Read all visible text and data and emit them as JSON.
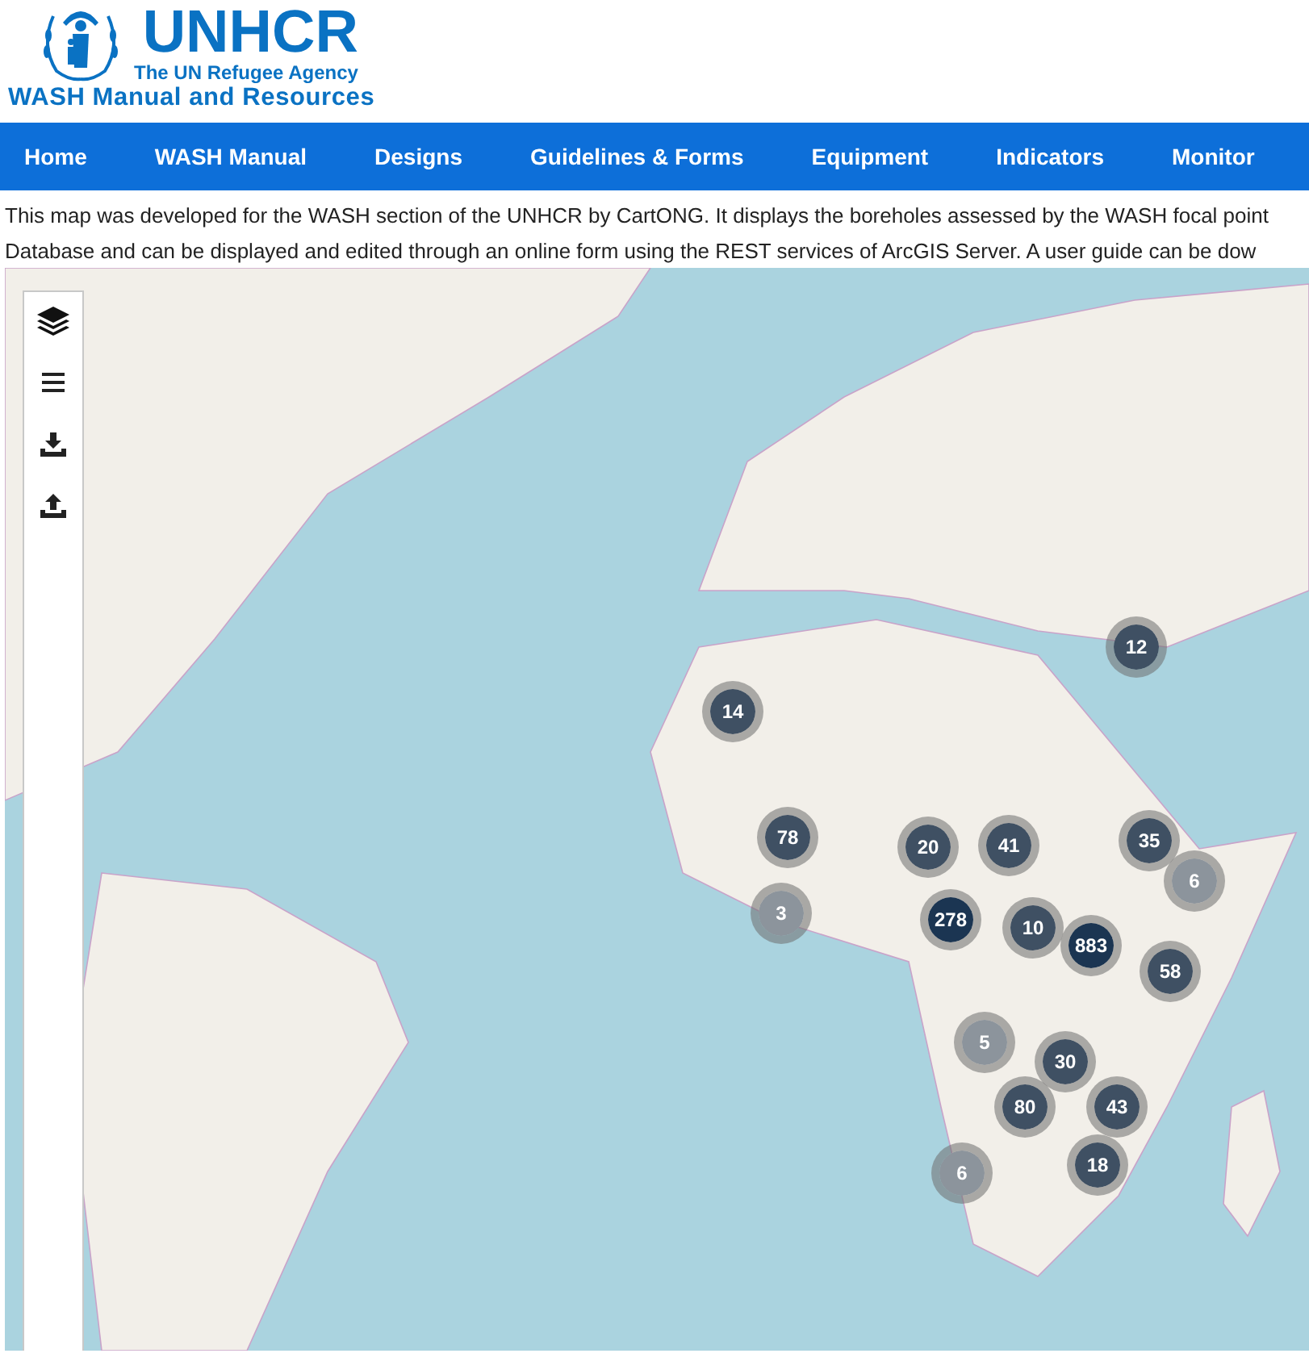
{
  "header": {
    "logo_title": "UNHCR",
    "logo_subtitle": "The UN Refugee Agency",
    "site_title": "WASH Manual and Resources"
  },
  "nav": [
    {
      "label": "Home"
    },
    {
      "label": "WASH Manual"
    },
    {
      "label": "Designs"
    },
    {
      "label": "Guidelines & Forms"
    },
    {
      "label": "Equipment"
    },
    {
      "label": "Indicators"
    },
    {
      "label": "Monitor"
    }
  ],
  "intro": [
    "This map was developed for the WASH section of the UNHCR by CartONG. It displays the boreholes assessed by the WASH focal point",
    "Database and can be displayed and edited through an online form using the REST services of ArcGIS Server. A user guide can be dow"
  ],
  "map": {
    "clusters": [
      {
        "count": "12",
        "color": "#3f5063"
      },
      {
        "count": "14",
        "color": "#3f5063"
      },
      {
        "count": "78",
        "color": "#3f5063"
      },
      {
        "count": "20",
        "color": "#3f5063"
      },
      {
        "count": "41",
        "color": "#3f5063"
      },
      {
        "count": "35",
        "color": "#3f5063"
      },
      {
        "count": "6",
        "color": "#8c949c"
      },
      {
        "count": "3",
        "color": "#8c949c"
      },
      {
        "count": "278",
        "color": "#1b3552"
      },
      {
        "count": "10",
        "color": "#3f5063"
      },
      {
        "count": "883",
        "color": "#1b3552"
      },
      {
        "count": "58",
        "color": "#3f5063"
      },
      {
        "count": "5",
        "color": "#8c949c"
      },
      {
        "count": "30",
        "color": "#3f5063"
      },
      {
        "count": "80",
        "color": "#3f5063"
      },
      {
        "count": "43",
        "color": "#3f5063"
      },
      {
        "count": "6",
        "color": "#8c949c"
      },
      {
        "count": "18",
        "color": "#3f5063"
      }
    ]
  }
}
